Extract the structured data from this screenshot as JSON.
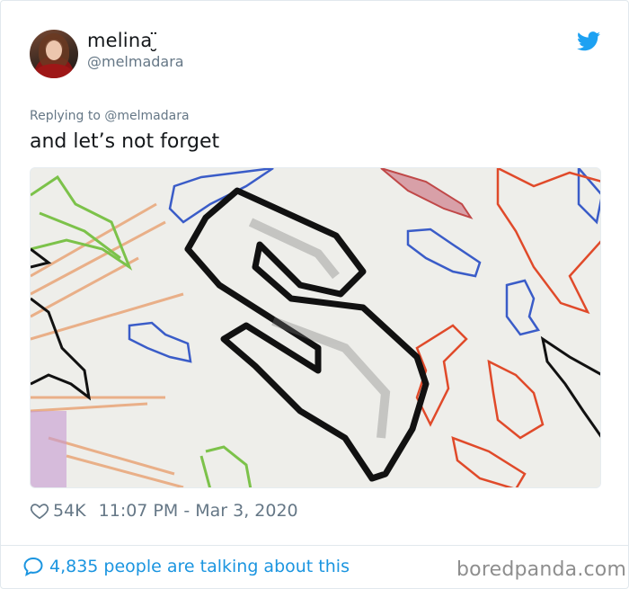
{
  "author": {
    "name": "melina ̮̈",
    "handle": "@melmadara"
  },
  "reply": {
    "text": "Replying to @melmadara"
  },
  "tweet": {
    "text": "and let’s not forget"
  },
  "media": {
    "description_icon": "graffiti-letter-s-drawing"
  },
  "meta": {
    "likes": "54K",
    "timestamp": "11:07 PM - Mar 3, 2020"
  },
  "footer": {
    "talking": "4,835 people are talking about this",
    "watermark": "boredpanda.com"
  },
  "colors": {
    "twitter_blue": "#1da1f2",
    "link_blue": "#1b95e0",
    "muted": "#657786"
  }
}
